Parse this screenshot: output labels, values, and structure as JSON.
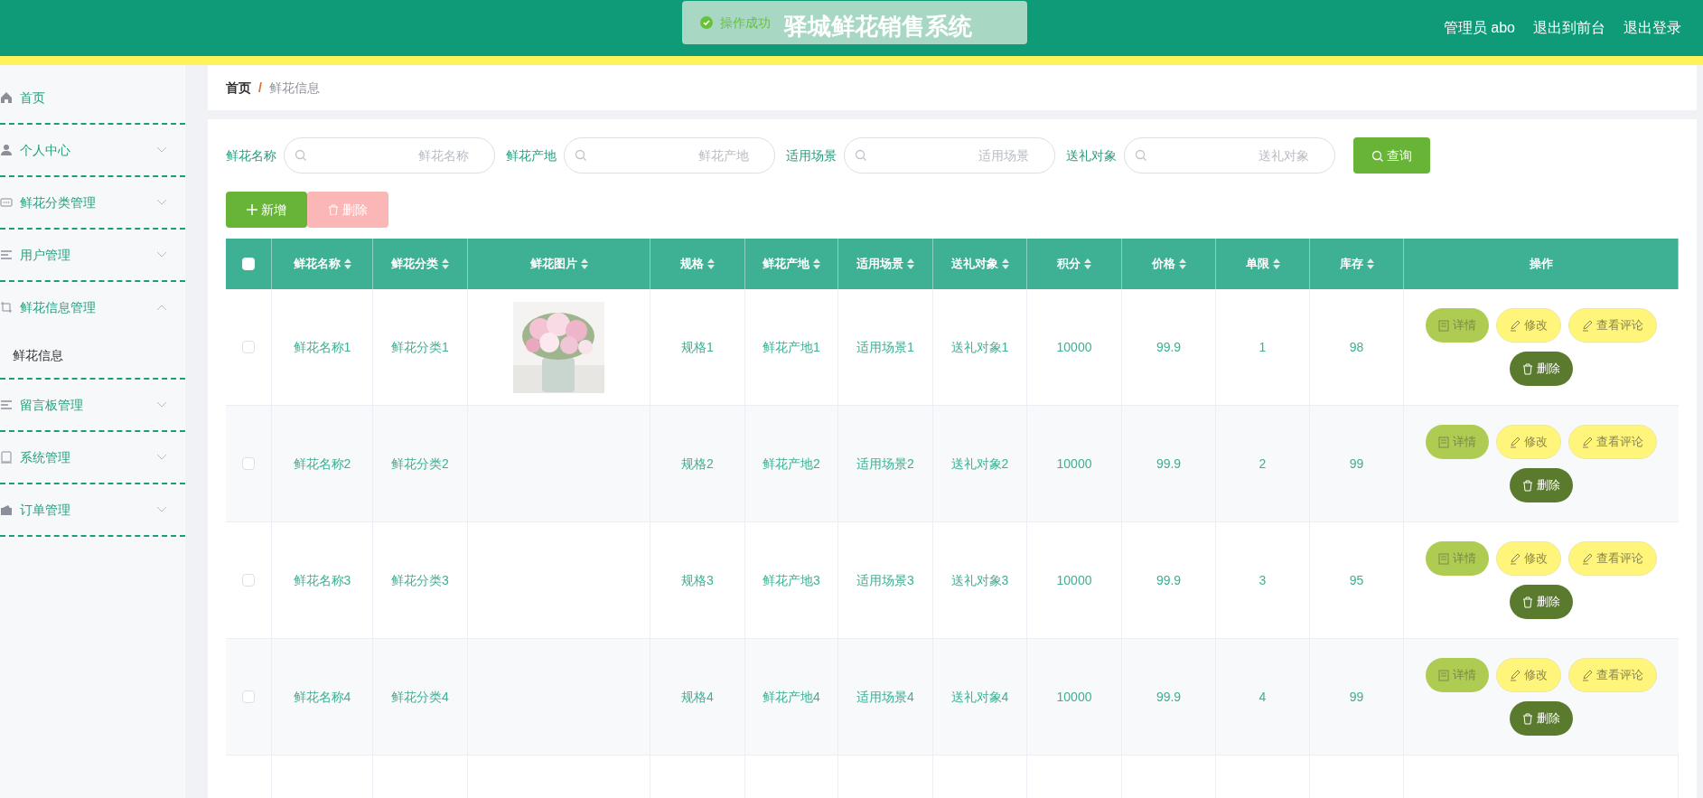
{
  "header": {
    "title": "驿城鲜花销售系统",
    "toast": "操作成功",
    "links": [
      "管理员 abo",
      "退出到前台",
      "退出登录"
    ]
  },
  "sidebar": {
    "items": [
      {
        "label": "首页",
        "expandable": false
      },
      {
        "label": "个人中心",
        "expandable": true,
        "expanded": false
      },
      {
        "label": "鲜花分类管理",
        "expandable": true,
        "expanded": false
      },
      {
        "label": "用户管理",
        "expandable": true,
        "expanded": false
      },
      {
        "label": "鲜花信息管理",
        "expandable": true,
        "expanded": true,
        "children": [
          {
            "label": "鲜花信息"
          }
        ]
      },
      {
        "label": "留言板管理",
        "expandable": true,
        "expanded": false
      },
      {
        "label": "系统管理",
        "expandable": true,
        "expanded": false
      },
      {
        "label": "订单管理",
        "expandable": true,
        "expanded": false
      }
    ]
  },
  "breadcrumb": {
    "separator": "/",
    "items": [
      "首页",
      "鲜花信息"
    ]
  },
  "search": {
    "fields": [
      {
        "label": "鲜花名称",
        "placeholder": "鲜花名称"
      },
      {
        "label": "鲜花产地",
        "placeholder": "鲜花产地"
      },
      {
        "label": "适用场景",
        "placeholder": "适用场景"
      },
      {
        "label": "送礼对象",
        "placeholder": "送礼对象"
      }
    ],
    "button": "查询"
  },
  "actions": [
    {
      "label": "新增",
      "kind": "add",
      "disabled": false
    },
    {
      "label": "删除",
      "kind": "delete",
      "disabled": true
    }
  ],
  "table": {
    "select_all_checked": false,
    "columns": [
      {
        "label": "鲜花名称",
        "sortable": true
      },
      {
        "label": "鲜花分类",
        "sortable": true
      },
      {
        "label": "鲜花图片",
        "sortable": true
      },
      {
        "label": "规格",
        "sortable": true
      },
      {
        "label": "鲜花产地",
        "sortable": true
      },
      {
        "label": "适用场景",
        "sortable": true
      },
      {
        "label": "送礼对象",
        "sortable": true
      },
      {
        "label": "积分",
        "sortable": true
      },
      {
        "label": "价格",
        "sortable": true
      },
      {
        "label": "单限",
        "sortable": true
      },
      {
        "label": "库存",
        "sortable": true
      },
      {
        "label": "操作",
        "sortable": false
      }
    ],
    "rows": [
      {
        "checked": false,
        "cells": [
          "鲜花名称1",
          "鲜花分类1",
          {
            "kind": "picture"
          },
          "规格1",
          "鲜花产地1",
          "适用场景1",
          "送礼对象1",
          "10000",
          "99.9",
          "1",
          "98"
        ],
        "buttons": [
          "详情",
          "修改",
          "查看评论",
          "删除"
        ]
      },
      {
        "checked": false,
        "cells": [
          "鲜花名称2",
          "鲜花分类2",
          null,
          "规格2",
          "鲜花产地2",
          "适用场景2",
          "送礼对象2",
          "10000",
          "99.9",
          "2",
          "99"
        ],
        "buttons": [
          "详情",
          "修改",
          "查看评论",
          "删除"
        ]
      },
      {
        "checked": false,
        "cells": [
          "鲜花名称3",
          "鲜花分类3",
          null,
          "规格3",
          "鲜花产地3",
          "适用场景3",
          "送礼对象3",
          "10000",
          "99.9",
          "3",
          "95"
        ],
        "buttons": [
          "详情",
          "修改",
          "查看评论",
          "删除"
        ]
      },
      {
        "checked": false,
        "cells": [
          "鲜花名称4",
          "鲜花分类4",
          null,
          "规格4",
          "鲜花产地4",
          "适用场景4",
          "送礼对象4",
          "10000",
          "99.9",
          "4",
          "99"
        ],
        "buttons": [
          "详情",
          "修改",
          "查看评论",
          "删除"
        ]
      }
    ]
  }
}
